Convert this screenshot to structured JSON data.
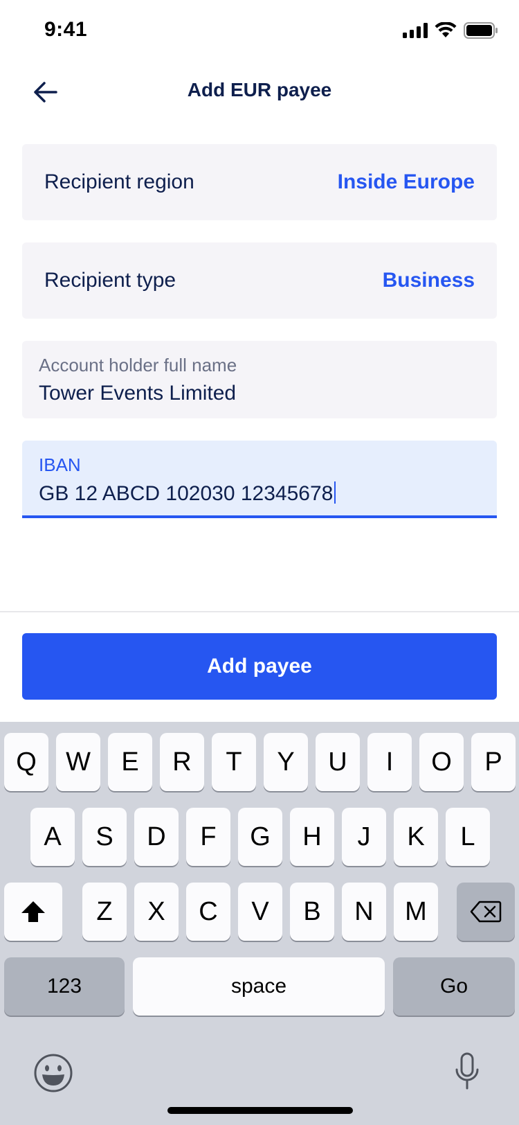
{
  "status": {
    "time": "9:41"
  },
  "nav": {
    "title": "Add EUR payee"
  },
  "form": {
    "region": {
      "label": "Recipient region",
      "value": "Inside Europe"
    },
    "type": {
      "label": "Recipient type",
      "value": "Business"
    },
    "holder": {
      "label": "Account holder full name",
      "value": "Tower Events Limited"
    },
    "iban": {
      "label": "IBAN",
      "value": "GB 12 ABCD 102030 12345678"
    }
  },
  "cta": {
    "label": "Add payee"
  },
  "keyboard": {
    "row1": [
      "Q",
      "W",
      "E",
      "R",
      "T",
      "Y",
      "U",
      "I",
      "O",
      "P"
    ],
    "row2": [
      "A",
      "S",
      "D",
      "F",
      "G",
      "H",
      "J",
      "K",
      "L"
    ],
    "row3": [
      "Z",
      "X",
      "C",
      "V",
      "B",
      "N",
      "M"
    ],
    "numbers_label": "123",
    "space_label": "space",
    "go_label": "Go"
  },
  "colors": {
    "accent": "#2656f1",
    "text": "#0e1f4d",
    "field_bg": "#f5f4f8",
    "active_field_bg": "#e6eefd"
  }
}
